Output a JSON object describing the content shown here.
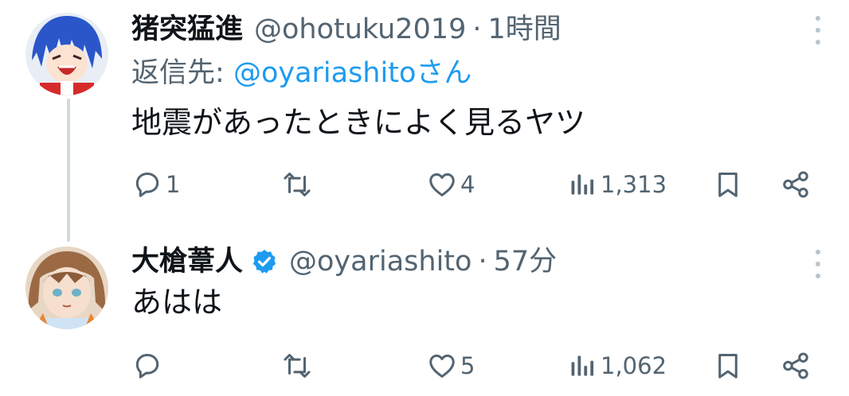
{
  "tweets": [
    {
      "name": "猪突猛進",
      "handle": "@ohotuku2019",
      "separator": "·",
      "time": "1時間",
      "reply_prefix": "返信先:",
      "reply_mention": "@oyariashito",
      "reply_suffix": "さん",
      "text": "地震があったときによく見るヤツ",
      "counts": {
        "reply": "1",
        "retweet": "",
        "like": "4",
        "views": "1,313"
      }
    },
    {
      "name": "大槍葦人",
      "verified": true,
      "handle": "@oyariashito",
      "separator": "·",
      "time": "57分",
      "text": "あはは",
      "counts": {
        "reply": "",
        "retweet": "",
        "like": "5",
        "views": "1,062"
      }
    }
  ],
  "colors": {
    "text": "#0f1419",
    "secondary": "#536471",
    "accent": "#1d9bf0",
    "thread_line": "#cfd9de"
  },
  "icons": [
    "reply-icon",
    "retweet-icon",
    "like-icon",
    "views-icon",
    "bookmark-icon",
    "share-icon",
    "more-icon",
    "verified-badge-icon"
  ]
}
